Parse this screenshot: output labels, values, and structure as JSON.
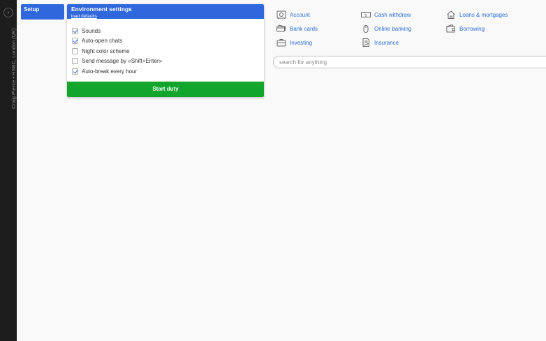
{
  "rail": {
    "operator_label": "Craig Pierce • HSBC, London (UK)",
    "toggle_glyph": "›"
  },
  "setup_tab": {
    "label": "Setup"
  },
  "settings": {
    "title": "Environment settings",
    "load_defaults_label": "load defaults",
    "options": [
      {
        "label": "Sounds",
        "checked": true
      },
      {
        "label": "Auto-open chats",
        "checked": true
      },
      {
        "label": "Night color scheme",
        "checked": false
      },
      {
        "label": "Send message by «Shift+Enter»",
        "checked": false
      },
      {
        "label": "Auto-break every hour",
        "checked": true
      }
    ],
    "start_button_label": "Start duty"
  },
  "quick_links": [
    {
      "label": "Account",
      "icon": "safe-icon"
    },
    {
      "label": "Cash withdraw",
      "icon": "banknote-icon"
    },
    {
      "label": "Loans & mortgages",
      "icon": "house-icon"
    },
    {
      "label": "Bank cards",
      "icon": "card-icon"
    },
    {
      "label": "Online banking",
      "icon": "mouse-icon"
    },
    {
      "label": "Borrowing",
      "icon": "wallet-icon"
    },
    {
      "label": "Investing",
      "icon": "briefcase-icon"
    },
    {
      "label": "Insurance",
      "icon": "contract-icon"
    }
  ],
  "search": {
    "placeholder": "search for anything",
    "value": ""
  },
  "colors": {
    "accent_blue": "#2f68dc",
    "start_green": "#12a52e",
    "link_blue": "#2b6fd6",
    "rail_dark": "#1d1d1d",
    "background": "#f9f9f9"
  }
}
